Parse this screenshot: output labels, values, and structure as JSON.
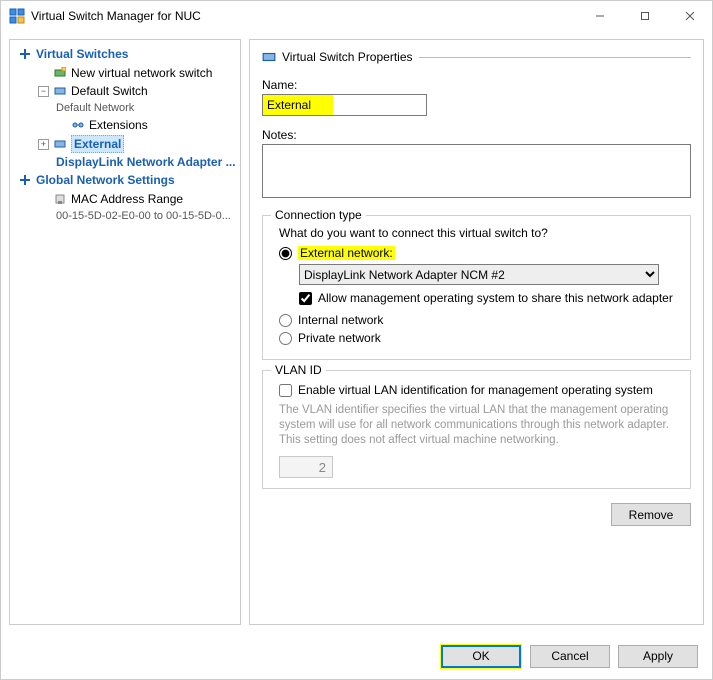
{
  "window": {
    "title": "Virtual Switch Manager for NUC"
  },
  "tree": {
    "section_switches": "Virtual Switches",
    "new_switch": "New virtual network switch",
    "default_switch": "Default Switch",
    "default_network": "Default Network",
    "extensions": "Extensions",
    "external": "External",
    "external_sub": "DisplayLink Network Adapter ...",
    "section_global": "Global Network Settings",
    "mac_range": "MAC Address Range",
    "mac_range_value": "00-15-5D-02-E0-00 to 00-15-5D-0..."
  },
  "props": {
    "header": "Virtual Switch Properties",
    "name_label": "Name:",
    "name_value": "External",
    "notes_label": "Notes:",
    "notes_value": ""
  },
  "conn": {
    "legend": "Connection type",
    "question": "What do you want to connect this virtual switch to?",
    "external": "External network:",
    "adapter": "DisplayLink Network Adapter NCM #2",
    "allow_mgmt": "Allow management operating system to share this network adapter",
    "internal": "Internal network",
    "private": "Private network"
  },
  "vlan": {
    "legend": "VLAN ID",
    "enable": "Enable virtual LAN identification for management operating system",
    "help": "The VLAN identifier specifies the virtual LAN that the management operating system will use for all network communications through this network adapter. This setting does not affect virtual machine networking.",
    "value": "2"
  },
  "buttons": {
    "remove": "Remove",
    "ok": "OK",
    "cancel": "Cancel",
    "apply": "Apply"
  }
}
